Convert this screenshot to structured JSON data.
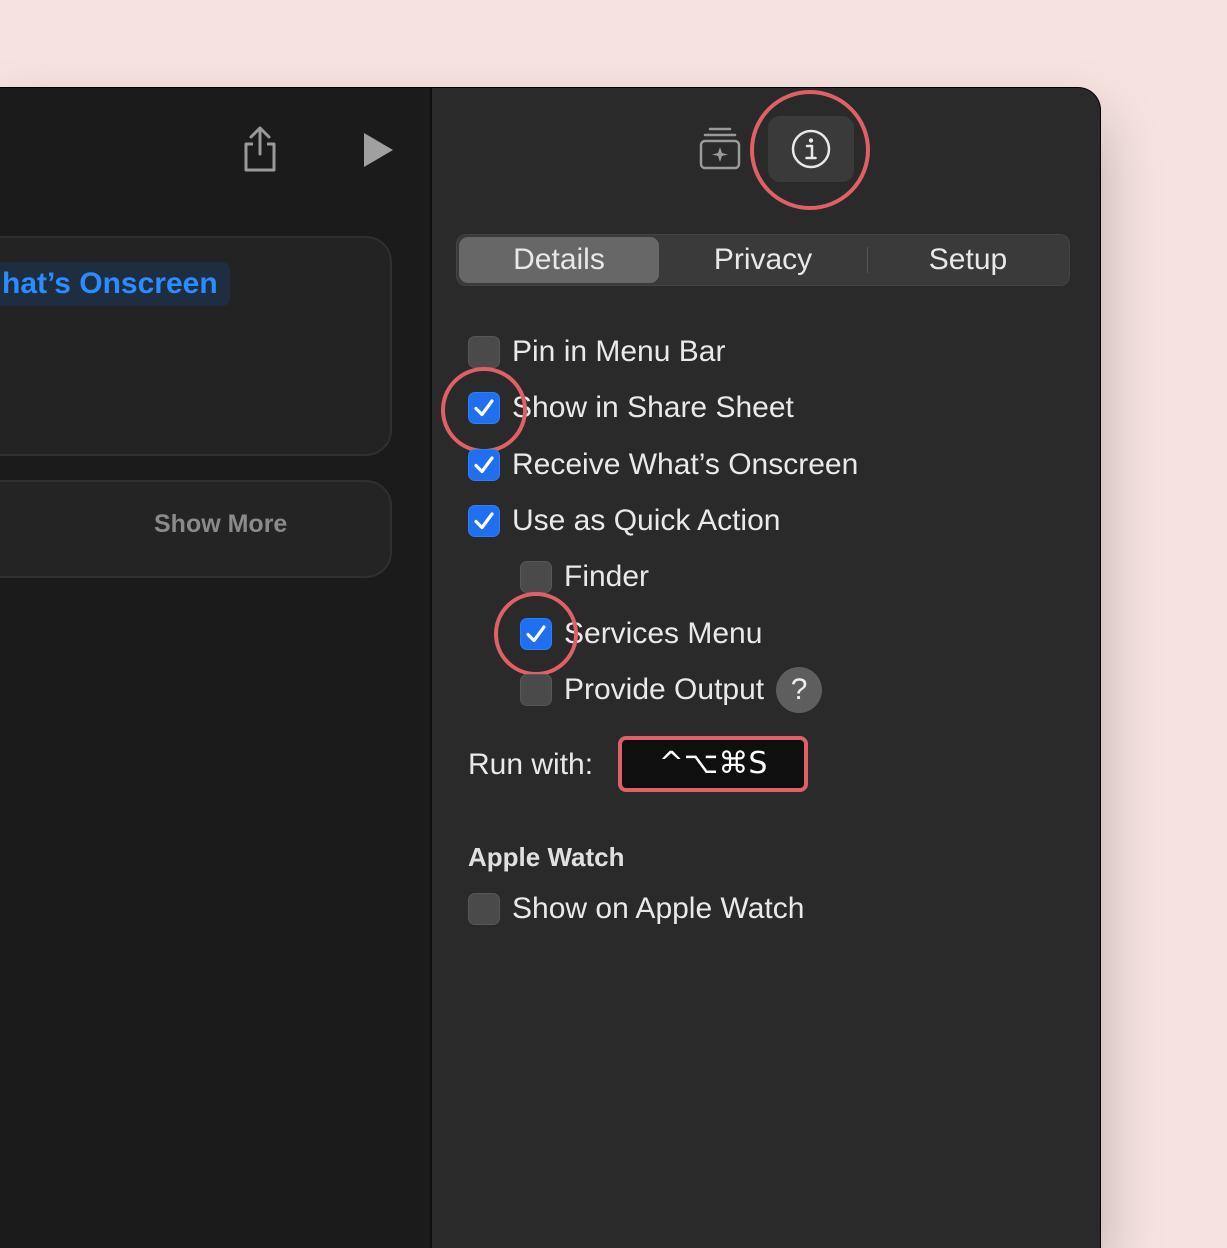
{
  "left_pane": {
    "variable_token": "hat’s Onscreen",
    "show_more": "Show More"
  },
  "right_pane": {
    "tabs": [
      {
        "label": "Details",
        "active": true
      },
      {
        "label": "Privacy",
        "active": false
      },
      {
        "label": "Setup",
        "active": false
      }
    ],
    "options": [
      {
        "label": "Pin in Menu Bar",
        "checked": false
      },
      {
        "label": "Show in Share Sheet",
        "checked": true
      },
      {
        "label": "Receive What’s Onscreen",
        "checked": true
      },
      {
        "label": "Use as Quick Action",
        "checked": true
      },
      {
        "label": "Finder",
        "checked": false
      },
      {
        "label": "Services Menu",
        "checked": true
      },
      {
        "label": "Provide Output",
        "checked": false
      }
    ],
    "help_label": "?",
    "run_with_label": "Run with:",
    "shortcut": "^⌥⌘S",
    "apple_watch": {
      "title": "Apple Watch",
      "option": {
        "label": "Show on Apple Watch",
        "checked": false
      }
    }
  },
  "icons": {
    "share": "share-icon",
    "run": "play-icon",
    "library": "action-library-icon",
    "info": "info-icon",
    "checkmark": "checkmark-icon"
  },
  "colors": {
    "accent": "#1f6ff0",
    "annotation": "#e06068",
    "background": "#f6e3e0"
  }
}
